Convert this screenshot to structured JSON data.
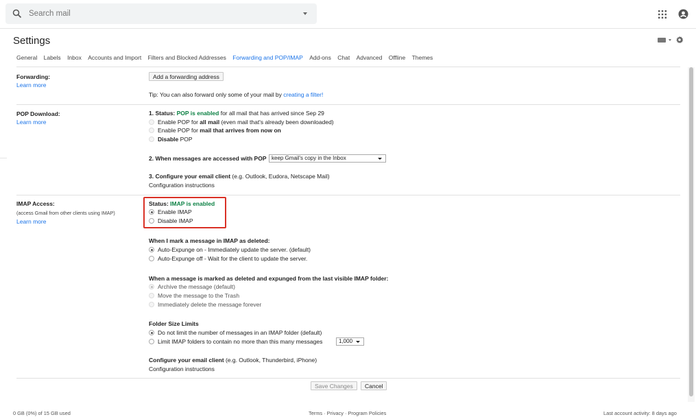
{
  "search": {
    "placeholder": "Search mail"
  },
  "header": {
    "title": "Settings"
  },
  "tabs": [
    "General",
    "Labels",
    "Inbox",
    "Accounts and Import",
    "Filters and Blocked Addresses",
    "Forwarding and POP/IMAP",
    "Add-ons",
    "Chat",
    "Advanced",
    "Offline",
    "Themes"
  ],
  "active_tab": "Forwarding and POP/IMAP",
  "forwarding": {
    "label": "Forwarding:",
    "learn": "Learn more",
    "button": "Add a forwarding address",
    "tip_prefix": "Tip: You can also forward only some of your mail by ",
    "tip_link": "creating a filter!"
  },
  "pop": {
    "label": "POP Download:",
    "learn": "Learn more",
    "status_prefix": "1. Status: ",
    "status_value": "POP is enabled",
    "status_suffix": " for all mail that has arrived since Sep 29",
    "opt1_a": "Enable POP for ",
    "opt1_b": "all mail",
    "opt1_c": " (even mail that's already been downloaded)",
    "opt2_a": "Enable POP for ",
    "opt2_b": "mail that arrives from now on",
    "opt3_a": "Disable",
    "opt3_b": " POP",
    "when_label": "2. When messages are accessed with POP",
    "when_select": "keep Gmail's copy in the Inbox",
    "config_bold": "3. Configure your email client",
    "config_rest": " (e.g. Outlook, Eudora, Netscape Mail)",
    "config_link": "Configuration instructions"
  },
  "imap": {
    "label": "IMAP Access:",
    "sub": "(access Gmail from other clients using IMAP)",
    "learn": "Learn more",
    "status_prefix": "Status: ",
    "status_value": "IMAP is enabled",
    "enable": "Enable IMAP",
    "disable": "Disable IMAP",
    "deleted_heading": "When I mark a message in IMAP as deleted:",
    "expunge_on": "Auto-Expunge on - Immediately update the server. (default)",
    "expunge_off": "Auto-Expunge off - Wait for the client to update the server.",
    "expunged_heading": "When a message is marked as deleted and expunged from the last visible IMAP folder:",
    "archive": "Archive the message (default)",
    "trash": "Move the message to the Trash",
    "delete_forever": "Immediately delete the message forever",
    "folder_heading": "Folder Size Limits",
    "no_limit": "Do not limit the number of messages in an IMAP folder (default)",
    "limit": "Limit IMAP folders to contain no more than this many messages",
    "limit_select": "1,000",
    "config_bold": "Configure your email client",
    "config_rest": " (e.g. Outlook, Thunderbird, iPhone)",
    "config_link": "Configuration instructions"
  },
  "actions": {
    "save": "Save Changes",
    "cancel": "Cancel"
  },
  "footer": {
    "storage": "0 GB (0%) of 15 GB used",
    "links": "Terms · Privacy · Program Policies",
    "activity": "Last account activity: 8 days ago"
  }
}
